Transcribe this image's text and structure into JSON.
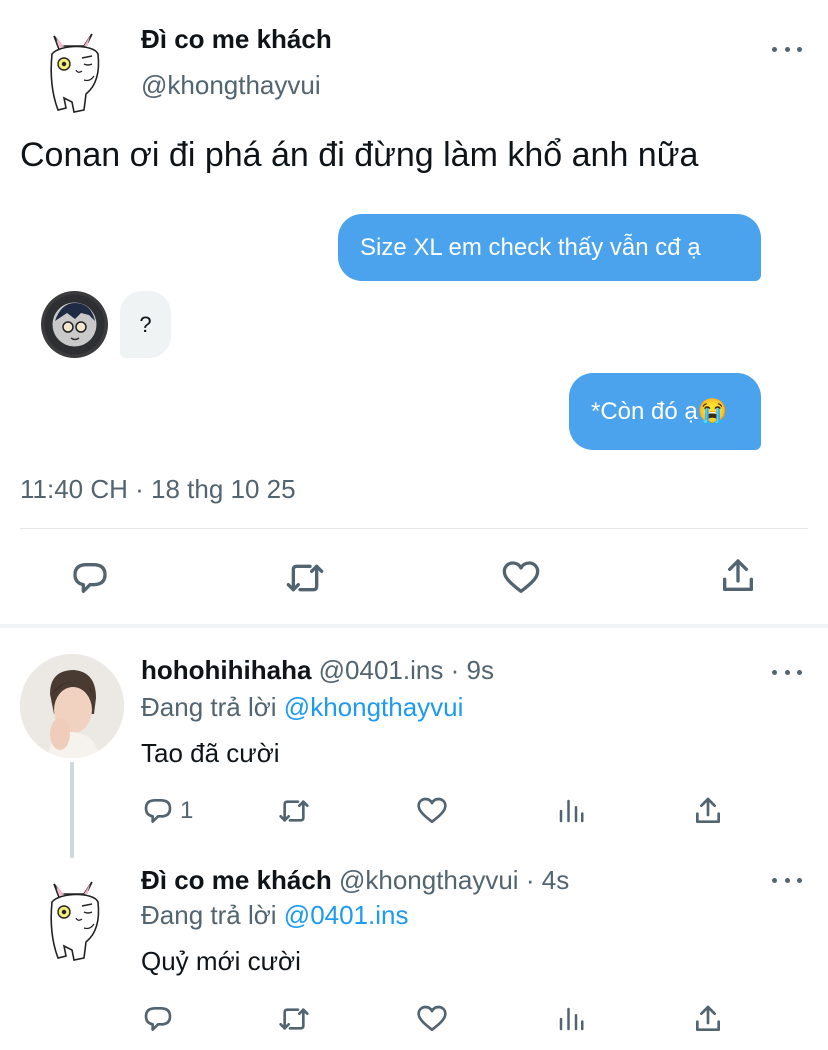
{
  "main_tweet": {
    "display_name": "Đì co me khách",
    "handle": "@khongthayvui",
    "text": "Conan ơi đi phá án đi đừng làm khổ anh nữa",
    "messages": [
      {
        "direction": "outgoing",
        "text": "Size XL em check thấy vẫn cđ ạ"
      },
      {
        "direction": "incoming",
        "text": "?"
      },
      {
        "direction": "outgoing",
        "text": "*Còn đó ạ😭"
      }
    ],
    "timestamp": "11:40 CH · 18 thg 10 25",
    "actions": [
      "reply-icon",
      "retweet-icon",
      "like-icon",
      "share-icon"
    ]
  },
  "replies": [
    {
      "display_name": "hohohihihaha",
      "handle": "@0401.ins",
      "separator": "·",
      "time": "9s",
      "replying_prefix": "Đang trả lời",
      "replying_to": "@khongthayvui",
      "text": "Tao đã cười",
      "reply_count": "1"
    },
    {
      "display_name": "Đì co me khách",
      "handle": "@khongthayvui",
      "separator": "·",
      "time": "4s",
      "replying_prefix": "Đang trả lời",
      "replying_to": "@0401.ins",
      "text": "Quỷ mới cười",
      "reply_count": ""
    }
  ],
  "colors": {
    "accent": "#1d9bf0",
    "bubble_outgoing": "#4aa3ec",
    "bubble_incoming": "#eff3f4",
    "secondary_text": "#536471"
  }
}
